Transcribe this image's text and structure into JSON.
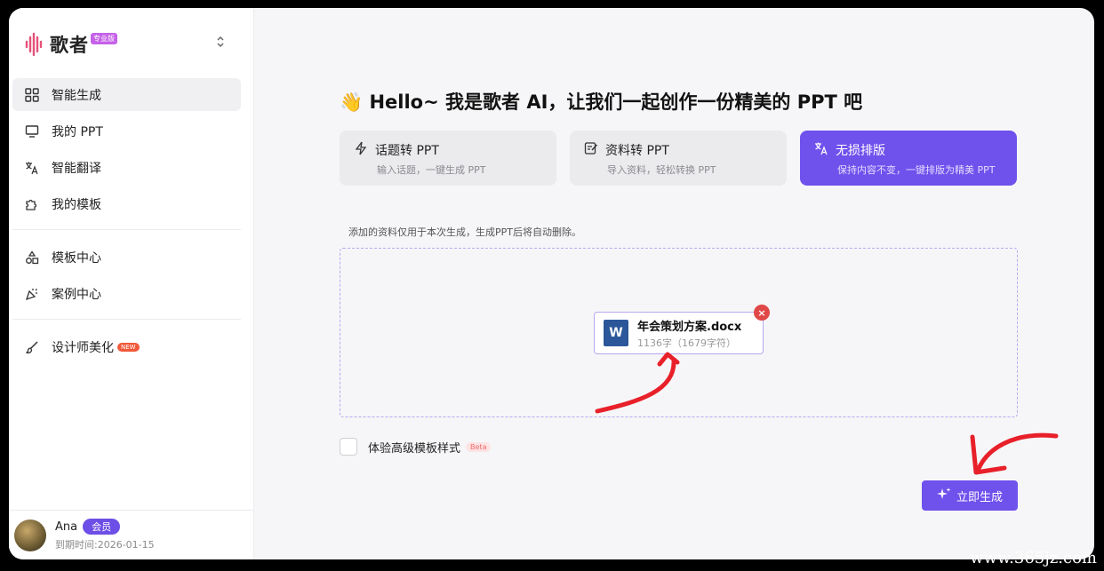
{
  "brand": {
    "name": "歌者",
    "badge": "专业版"
  },
  "sidebar": {
    "items": [
      {
        "label": "智能生成",
        "icon": "grid-icon",
        "active": true
      },
      {
        "label": "我的 PPT",
        "icon": "monitor-icon"
      },
      {
        "label": "智能翻译",
        "icon": "translate-icon"
      },
      {
        "label": "我的模板",
        "icon": "puzzle-icon"
      },
      {
        "label": "模板中心",
        "icon": "shapes-icon"
      },
      {
        "label": "案例中心",
        "icon": "party-icon"
      },
      {
        "label": "设计师美化",
        "icon": "brush-icon",
        "badge": "NEW"
      }
    ]
  },
  "user": {
    "name": "Ana",
    "badge": "会员",
    "expire": "到期时间:2026-01-15"
  },
  "main": {
    "headline": "👋 Hello~ 我是歌者 AI，让我们一起创作一份精美的 PPT 吧",
    "modes": [
      {
        "title": "话题转 PPT",
        "desc": "输入话题，一键生成 PPT",
        "icon": "lightning-icon"
      },
      {
        "title": "资料转 PPT",
        "desc": "导入资料，轻松转换 PPT",
        "icon": "edit-doc-icon"
      },
      {
        "title": "无损排版",
        "desc": "保持内容不变，一键排版为精美 PPT",
        "icon": "translate-icon",
        "active": true
      }
    ],
    "notice": "添加的资料仅用于本次生成，生成PPT后将自动删除。",
    "file": {
      "name": "年会策划方案.docx",
      "meta": "1136字（1679字符）",
      "icon_letter": "W"
    },
    "checkbox_label": "体验高级模板样式",
    "beta": "Beta",
    "generate_label": "立即生成"
  },
  "colors": {
    "accent": "#6f51ec",
    "annotation": "#e8202a"
  },
  "watermark": "www.365jz.com"
}
